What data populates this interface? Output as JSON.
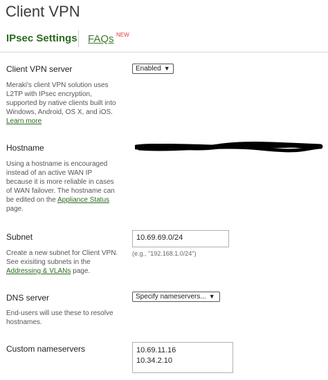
{
  "page": {
    "title": "Client VPN"
  },
  "tabs": {
    "active": "IPsec Settings",
    "faqs": "FAQs",
    "new_badge": "NEW"
  },
  "client_vpn_server": {
    "label": "Client VPN server",
    "help_line1": "Meraki's client VPN solution uses",
    "help_line2": "L2TP with IPsec encryption,",
    "help_line3": "supported by native clients built into",
    "help_line4": "Windows, Android, OS X, and iOS.",
    "learn_more": "Learn more",
    "select_value": "Enabled"
  },
  "hostname": {
    "label": "Hostname",
    "help_line1": "Using a hostname is encouraged",
    "help_line2": "instead of an active WAN IP",
    "help_line3": "because it is more reliable in cases",
    "help_line4": "of WAN failover. The hostname can",
    "help_line5_pre": "be edited on the ",
    "help_link": "Appliance Status",
    "help_line6": "page.",
    "value_redacted": true
  },
  "subnet": {
    "label": "Subnet",
    "help_line1": "Create a new subnet for Client VPN.",
    "help_line2": "See exisiting subnets in the",
    "help_link": "Addressing & VLANs",
    "help_line3_post": " page.",
    "value": "10.69.69.0/24",
    "example": "(e.g., \"192.168.1.0/24\")"
  },
  "dns_server": {
    "label": "DNS server",
    "help_line1": "End-users will use these to resolve",
    "help_line2": "hostnames.",
    "select_value": "Specify nameservers..."
  },
  "custom_nameservers": {
    "label": "Custom nameservers",
    "line1": "10.69.11.16",
    "line2": "10.34.2.10"
  },
  "colors": {
    "accent_green": "#2d6a22",
    "new_red": "#e23b3b"
  }
}
